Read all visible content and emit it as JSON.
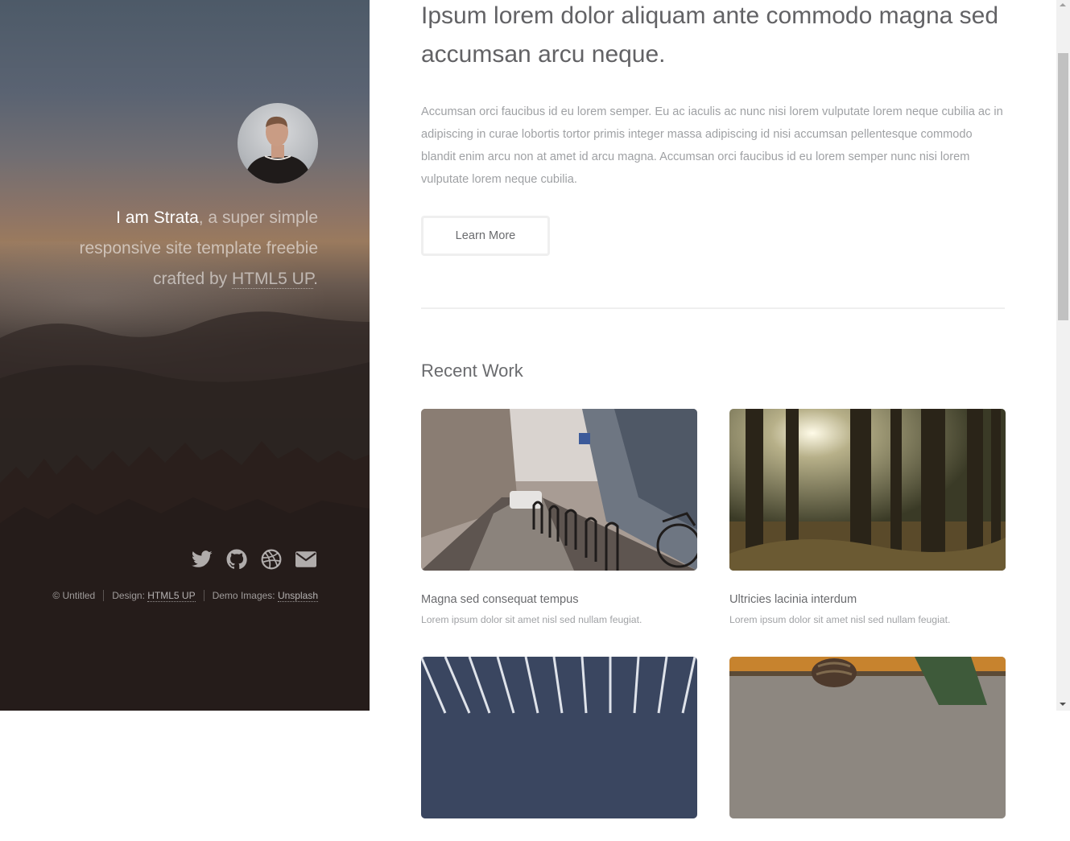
{
  "sidebar": {
    "intro": {
      "name": "I am Strata",
      "text_before_link": ", a super simple responsive site template freebie crafted by ",
      "link": "HTML5 UP",
      "text_after_link": "."
    },
    "social_icons": [
      "twitter-icon",
      "github-icon",
      "dribbble-icon",
      "envelope-icon"
    ],
    "copyright": {
      "owner": "© Untitled",
      "design_label": "Design: ",
      "design_link": "HTML5 UP",
      "images_label": "Demo Images: ",
      "images_link": "Unsplash"
    }
  },
  "main": {
    "headline": "Ipsum lorem dolor aliquam ante commodo magna sed accumsan arcu neque.",
    "lead": "Accumsan orci faucibus id eu lorem semper. Eu ac iaculis ac nunc nisi lorem vulputate lorem neque cubilia ac in adipiscing in curae lobortis tortor primis integer massa adipiscing id nisi accumsan pellentesque commodo blandit enim arcu non at amet id arcu magna. Accumsan orci faucibus id eu lorem semper nunc nisi lorem vulputate lorem neque cubilia.",
    "button_label": "Learn More",
    "recent_work": {
      "title": "Recent Work",
      "items": [
        {
          "title": "Magna sed consequat tempus",
          "description": "Lorem ipsum dolor sit amet nisl sed nullam feugiat."
        },
        {
          "title": "Ultricies lacinia interdum",
          "description": "Lorem ipsum dolor sit amet nisl sed nullam feugiat."
        },
        {
          "title": "",
          "description": ""
        },
        {
          "title": "",
          "description": ""
        }
      ]
    }
  },
  "colors": {
    "heading": "#626265",
    "body_text": "#9fa1a4",
    "border": "#efefef",
    "sidebar_dark": "#231b1b"
  }
}
